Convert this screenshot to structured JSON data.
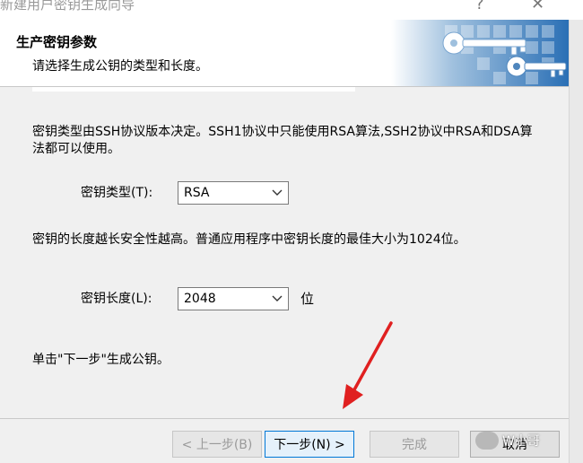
{
  "window": {
    "title": "新建用户密钥生成向导",
    "help_glyph": "?",
    "close_glyph": "✕"
  },
  "header": {
    "title": "生产密钥参数",
    "subtitle": "请选择生成公钥的类型和长度。"
  },
  "main": {
    "key_type_desc": "密钥类型由SSH协议版本决定。SSH1协议中只能使用RSA算法,SSH2协议中RSA和DSA算法都可以使用。",
    "key_type_label": "密钥类型(T):",
    "key_type_value": "RSA",
    "key_length_desc": "密钥的长度越长安全性越高。普通应用程序中密钥长度的最佳大小为1024位。",
    "key_length_label": "密钥长度(L):",
    "key_length_value": "2048",
    "key_length_unit": "位",
    "hint": "单击\"下一步\"生成公钥。"
  },
  "buttons": {
    "back": "< 上一步(B)",
    "next": "下一步(N) >",
    "finish": "完成",
    "cancel": "取消"
  },
  "watermark": {
    "text": "W小哥"
  },
  "colors": {
    "accent": "#0078d7",
    "arrow": "#e02020",
    "header_art": "#2a6fb5"
  }
}
